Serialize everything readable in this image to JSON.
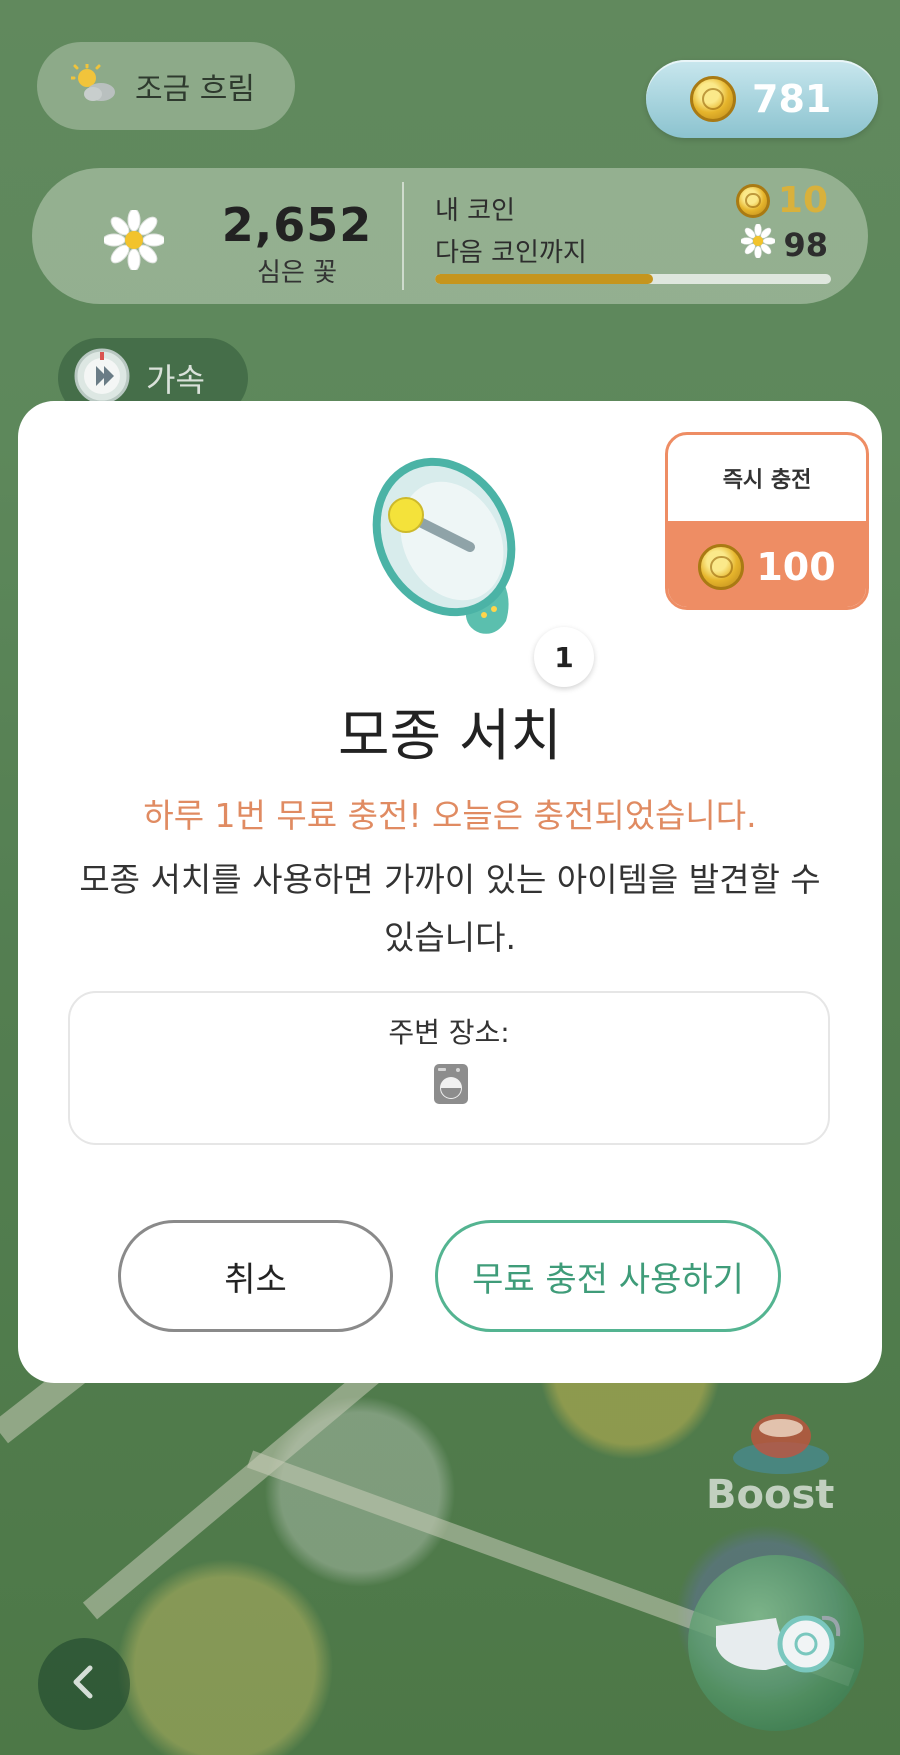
{
  "hud": {
    "weather": {
      "icon": "partly-cloudy-icon",
      "label": "조금 흐림"
    },
    "coins": {
      "icon": "coin-icon",
      "value": "781"
    },
    "stats": {
      "planted_count": "2,652",
      "planted_label": "심은 꽃",
      "my_coin_label": "내 코인",
      "my_coin_value": "10",
      "next_coin_label": "다음 코인까지",
      "next_coin_value": "98",
      "next_coin_progress": 0.55
    },
    "speed_chip": {
      "icon": "speed-timer-icon",
      "label": "가속"
    }
  },
  "modal": {
    "instant_charge": {
      "label": "즉시 충전",
      "cost": "100"
    },
    "item_icon": "megaphone-icon",
    "item_count": "1",
    "title": "모종 서치",
    "notice": "하루 1번 무료 충전! 오늘은 충전되었습니다.",
    "description": "모종 서치를 사용하면 가까이 있는 아이템을  발견할 수 있습니다.",
    "nearby": {
      "label": "주변 장소:",
      "place_icon": "washing-machine-icon"
    },
    "buttons": {
      "cancel": "취소",
      "use_free": "무료 충전 사용하기"
    }
  },
  "bottom": {
    "boost_label": "Boost",
    "whistle_icon": "whistle-icon",
    "back_icon": "chevron-left-icon"
  },
  "colors": {
    "accent_orange": "#ee8d64",
    "notice_orange": "#e08b62",
    "accent_green": "#54b491",
    "coin_gold": "#d8b13c"
  }
}
